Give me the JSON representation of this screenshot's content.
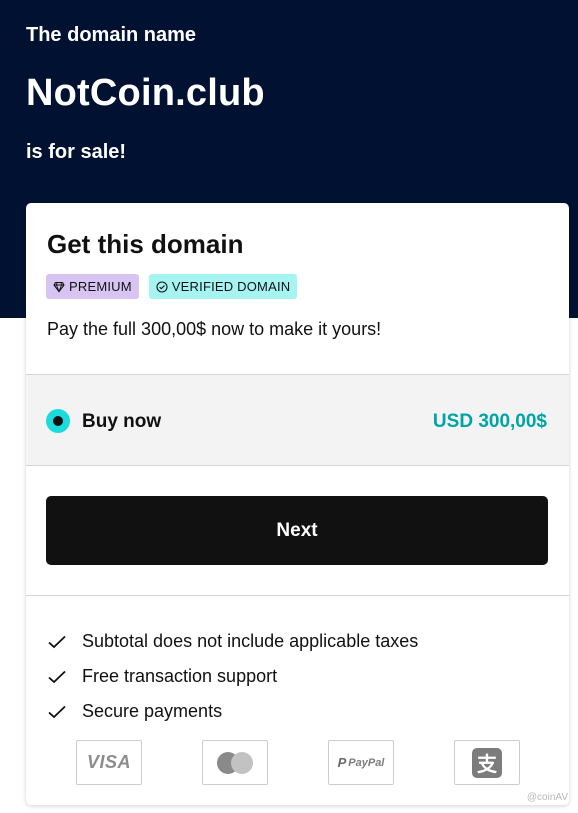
{
  "hero": {
    "pre_text": "The domain name",
    "domain_name": "NotCoin.club",
    "post_text": "is for sale!",
    "bg_color": "#001131"
  },
  "card": {
    "title": "Get this domain",
    "badges": [
      {
        "icon": "diamond-icon",
        "label": "PREMIUM",
        "color": "#d8c4f3"
      },
      {
        "icon": "check-circle-icon",
        "label": "VERIFIED DOMAIN",
        "color": "#a6f4f1"
      }
    ],
    "description": "Pay the full 300,00$ now to make it yours!",
    "option": {
      "label": "Buy now",
      "price": "USD 300,00$",
      "selected": true,
      "accent_color": "#1bdbdb",
      "price_color": "#00a4a6"
    },
    "next_button": "Next",
    "features": [
      "Subtotal does not include applicable taxes",
      "Free transaction support",
      "Secure payments"
    ],
    "payment_methods": {
      "visa": "VISA",
      "mastercard": "mastercard-icon",
      "paypal_p": "P",
      "paypal": "PayPal",
      "alipay": "支"
    }
  },
  "watermark": "@coinAV"
}
